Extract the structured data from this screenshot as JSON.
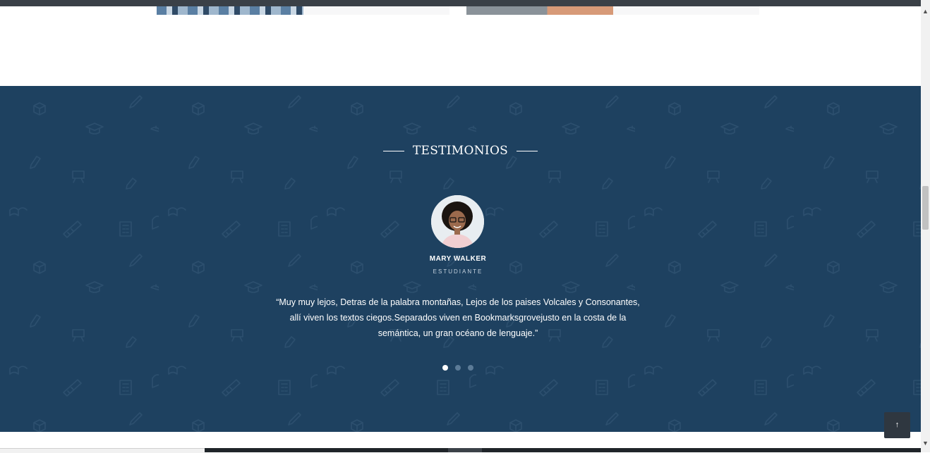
{
  "testimonials": {
    "heading": "TESTIMONIOS",
    "name": "MARY WALKER",
    "role": "ESTUDIANTE",
    "quote": "“Muy muy lejos, Detras de la palabra montañas, Lejos de los paises Volcales y Consonantes, allí viven los textos ciegos.Separados viven en Bookmarksgrovejusto en la costa de la semántica, un gran océano de lenguaje.”",
    "dots": [
      {
        "label": "slide-1",
        "active": true
      },
      {
        "label": "slide-2",
        "active": false
      },
      {
        "label": "slide-3",
        "active": false
      }
    ]
  },
  "colors": {
    "section_bg": "#1e4160",
    "pattern": "#2c4f6e",
    "text": "#ffffff"
  },
  "icons": {
    "back_to_top": "arrow-up-icon",
    "pattern_icons": [
      "graduation-cap-icon",
      "backpack-icon",
      "pencil-icon",
      "book-icon",
      "ruler-icon",
      "cube-icon",
      "easel-icon",
      "calculator-icon"
    ]
  },
  "back_to_top_glyph": "↑",
  "scrollbar": {
    "up": "▲",
    "down": "▼"
  }
}
